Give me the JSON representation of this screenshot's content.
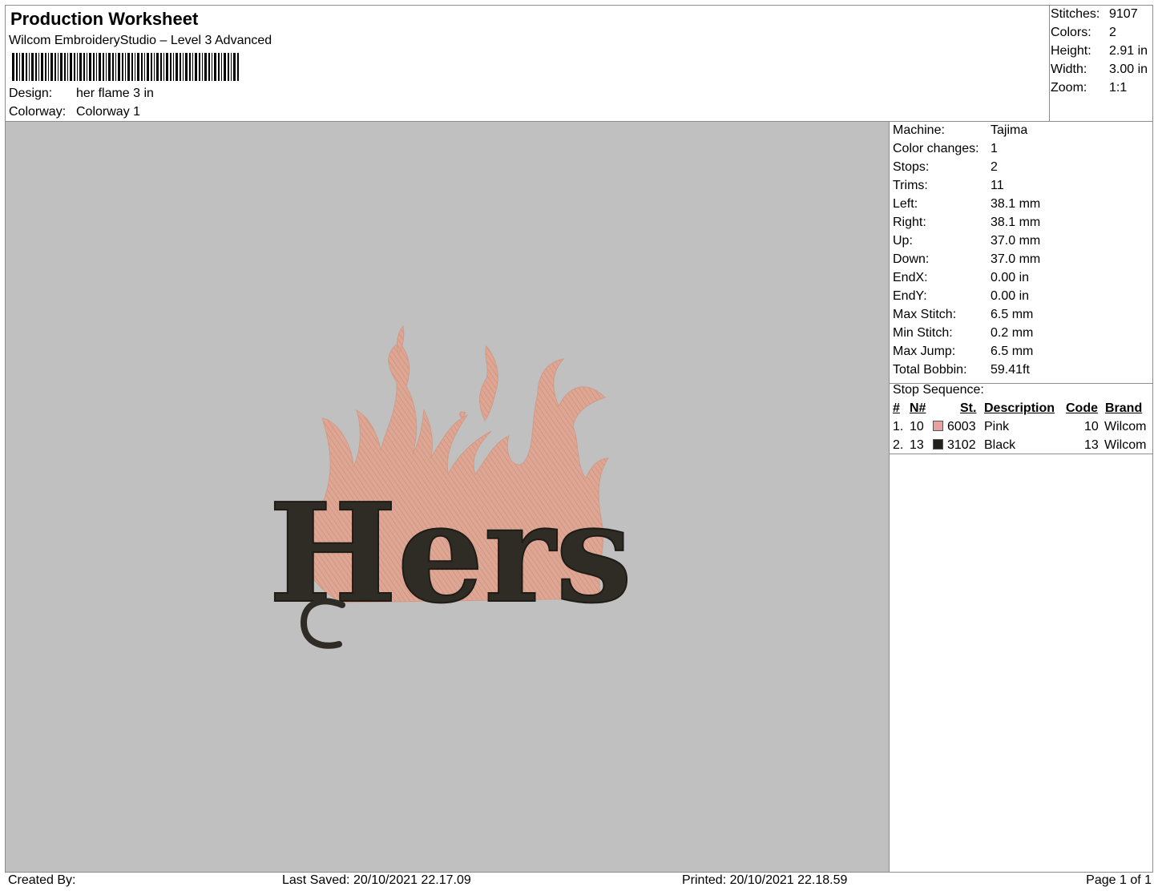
{
  "header": {
    "title": "Production Worksheet",
    "software": "Wilcom EmbroideryStudio – Level 3 Advanced",
    "design_label": "Design:",
    "design_value": "her flame 3 in",
    "colorway_label": "Colorway:",
    "colorway_value": "Colorway 1"
  },
  "summary": [
    {
      "label": "Stitches:",
      "value": "9107"
    },
    {
      "label": "Colors:",
      "value": "2"
    },
    {
      "label": "Height:",
      "value": "2.91 in"
    },
    {
      "label": "Width:",
      "value": "3.00 in"
    },
    {
      "label": "Zoom:",
      "value": "1:1"
    }
  ],
  "machine_info": [
    {
      "label": "Machine:",
      "value": "Tajima"
    },
    {
      "label": "Color changes:",
      "value": "1"
    },
    {
      "label": "Stops:",
      "value": "2"
    },
    {
      "label": "Trims:",
      "value": "11"
    },
    {
      "label": "Left:",
      "value": "38.1 mm"
    },
    {
      "label": "Right:",
      "value": "38.1 mm"
    },
    {
      "label": "Up:",
      "value": "37.0 mm"
    },
    {
      "label": "Down:",
      "value": "37.0 mm"
    },
    {
      "label": "EndX:",
      "value": "0.00 in"
    },
    {
      "label": "EndY:",
      "value": "0.00 in"
    },
    {
      "label": "Max Stitch:",
      "value": "6.5 mm"
    },
    {
      "label": "Min Stitch:",
      "value": "0.2 mm"
    },
    {
      "label": "Max Jump:",
      "value": "6.5 mm"
    },
    {
      "label": "Total Bobbin:",
      "value": "59.41ft"
    }
  ],
  "stop_sequence": {
    "title": "Stop Sequence:",
    "columns": {
      "num": "#",
      "needle": "N#",
      "st": "St.",
      "description": "Description",
      "code": "Code",
      "brand": "Brand"
    },
    "rows": [
      {
        "num": "1.",
        "needle": "10",
        "color": "#e8a0a0",
        "st": "6003",
        "description": "Pink",
        "code": "10",
        "brand": "Wilcom"
      },
      {
        "num": "2.",
        "needle": "13",
        "color": "#231f1a",
        "st": "3102",
        "description": "Black",
        "code": "13",
        "brand": "Wilcom"
      }
    ]
  },
  "design": {
    "text": "Hers",
    "thread_pink": "#e0aa98",
    "thread_black": "#2f2c26",
    "background": "#c0c0c0"
  },
  "footer": {
    "created_by": "Created By:",
    "last_saved": "Last Saved: 20/10/2021 22.17.09",
    "printed": "Printed: 20/10/2021 22.18.59",
    "page": "Page 1 of 1"
  }
}
